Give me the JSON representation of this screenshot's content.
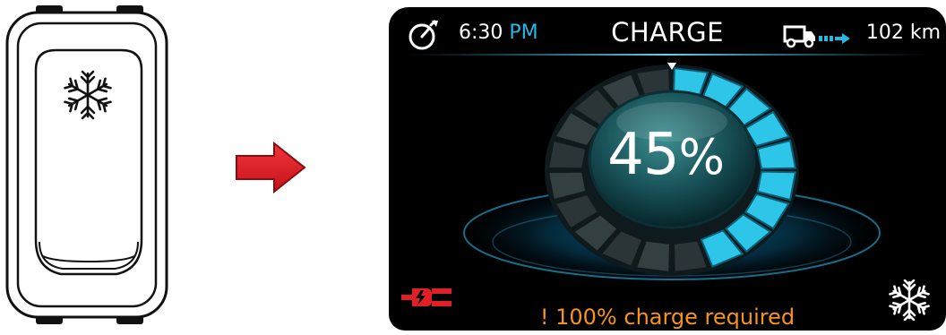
{
  "switch": {
    "icon": "snowflake-icon"
  },
  "arrow": {
    "color": "#e11f26",
    "icon": "right-arrow-icon"
  },
  "display": {
    "status_bar": {
      "time": "6:30",
      "ampm": "PM",
      "title": "CHARGE",
      "range": "102 km",
      "timer_icon": "stopwatch-icon",
      "range_icon": "truck-range-icon"
    },
    "battery": {
      "level_text": "45",
      "percent_sign": "%",
      "level_fraction": 0.45,
      "accent_color": "#2ec6e8"
    },
    "warning": "! 100% charge required",
    "warning_color": "#f7941d",
    "plug_icon": "charging-plug-icon",
    "plug_color": "#e11f26",
    "climate_icon": "snowflake-icon"
  }
}
